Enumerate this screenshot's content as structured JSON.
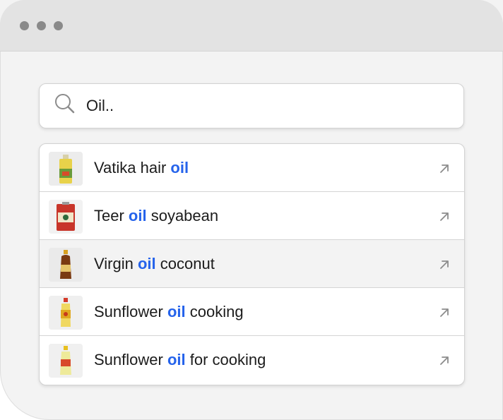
{
  "window": {
    "dots": [
      "dot",
      "dot",
      "dot"
    ]
  },
  "search": {
    "value": "Oil..",
    "icon": "search-icon"
  },
  "results": [
    {
      "before": "Vatika hair ",
      "match": "oil",
      "after": "",
      "icon": "arrow-up-right-icon",
      "thumb": "hair-oil-bottle"
    },
    {
      "before": "Teer ",
      "match": "oil",
      "after": " soyabean",
      "icon": "arrow-up-right-icon",
      "thumb": "oil-tin-can"
    },
    {
      "before": "Virgin ",
      "match": "oil",
      "after": " coconut",
      "icon": "arrow-up-right-icon",
      "thumb": "coconut-oil-bottle",
      "highlighted": true
    },
    {
      "before": "Sunflower ",
      "match": "oil",
      "after": " cooking",
      "icon": "arrow-up-right-icon",
      "thumb": "sunflower-oil-bottle"
    },
    {
      "before": "Sunflower ",
      "match": "oil",
      "after": " for cooking",
      "icon": "arrow-up-right-icon",
      "thumb": "cooking-oil-bottle"
    }
  ],
  "colors": {
    "match": "#2563eb",
    "text": "#1c1c1c",
    "titlebar": "#e3e3e3",
    "background": "#f3f3f3",
    "dot": "#8a8a8a"
  }
}
